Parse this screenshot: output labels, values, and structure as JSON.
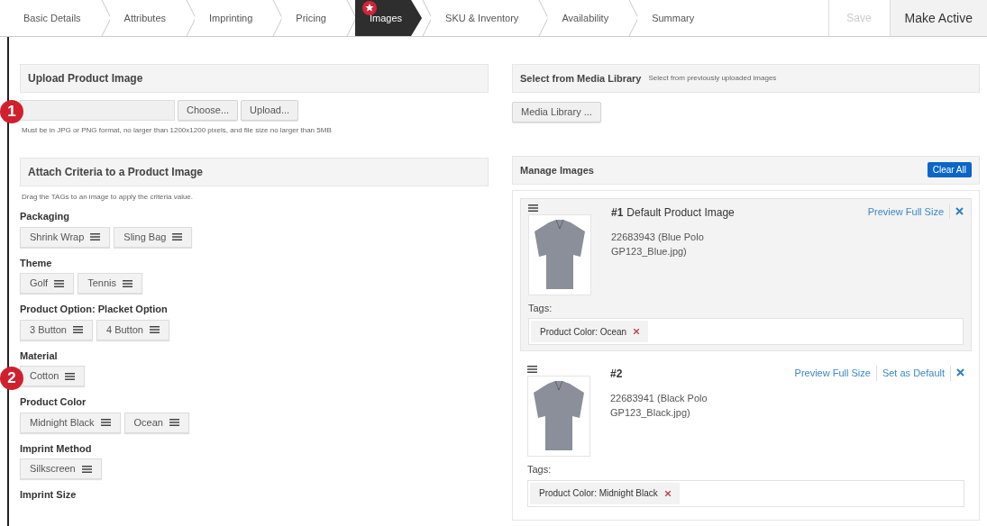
{
  "tabs": [
    {
      "label": "Basic Details",
      "selected": false,
      "flagged": false
    },
    {
      "label": "Attributes",
      "selected": false,
      "flagged": false
    },
    {
      "label": "Imprinting",
      "selected": false,
      "flagged": false
    },
    {
      "label": "Pricing",
      "selected": false,
      "flagged": false
    },
    {
      "label": "Images",
      "selected": true,
      "flagged": true
    },
    {
      "label": "SKU & Inventory",
      "selected": false,
      "flagged": false
    },
    {
      "label": "Availability",
      "selected": false,
      "flagged": false
    },
    {
      "label": "Summary",
      "selected": false,
      "flagged": false
    }
  ],
  "actions": [
    {
      "label": "Save",
      "disabled": true
    },
    {
      "label": "Make Active",
      "disabled": false
    }
  ],
  "upload": {
    "title": "Upload Product Image",
    "buttons": [
      "Choose...",
      "Upload..."
    ],
    "hint": "Must be in JPG or PNG format, no larger than 1200x1200 pixels, and file size no larger than 5MB"
  },
  "criteria": {
    "title": "Attach Criteria to a Product Image",
    "hint": "Drag the TAGs to an image to apply the criteria value.",
    "groups": [
      {
        "label": "Packaging",
        "tags": [
          "Shrink Wrap",
          "Sling Bag"
        ]
      },
      {
        "label": "Theme",
        "tags": [
          "Golf",
          "Tennis"
        ]
      },
      {
        "label": "Product Option: Placket Option",
        "tags": [
          "3 Button",
          "4 Button"
        ]
      },
      {
        "label": "Material",
        "tags": [
          "Cotton"
        ]
      },
      {
        "label": "Product Color",
        "tags": [
          "Midnight Black",
          "Ocean"
        ]
      },
      {
        "label": "Imprint Method",
        "tags": [
          "Silkscreen"
        ]
      },
      {
        "label": "Imprint Size"
      }
    ]
  },
  "media_library": {
    "title": "Select from Media Library",
    "subtitle": "Select from previously uploaded images",
    "button": "Media Library ..."
  },
  "manage": {
    "title": "Manage Images",
    "clear_button": "Clear All",
    "images": [
      {
        "number": "#1",
        "caption": "Default Product Image",
        "default": true,
        "name": "22683943 (Blue Polo",
        "file": "GP123_Blue.jpg)",
        "links": [
          "Preview Full Size"
        ],
        "tags_label": "Tags:",
        "tags": [
          "Product Color: Ocean"
        ]
      },
      {
        "number": "#2",
        "default": false,
        "name": "22683941 (Black Polo",
        "file": "GP123_Black.jpg)",
        "links": [
          "Preview Full Size",
          "Set as Default"
        ],
        "tags_label": "Tags:",
        "tags": [
          "Product Color: Midnight Black"
        ]
      }
    ]
  },
  "callouts": [
    "1",
    "2"
  ]
}
